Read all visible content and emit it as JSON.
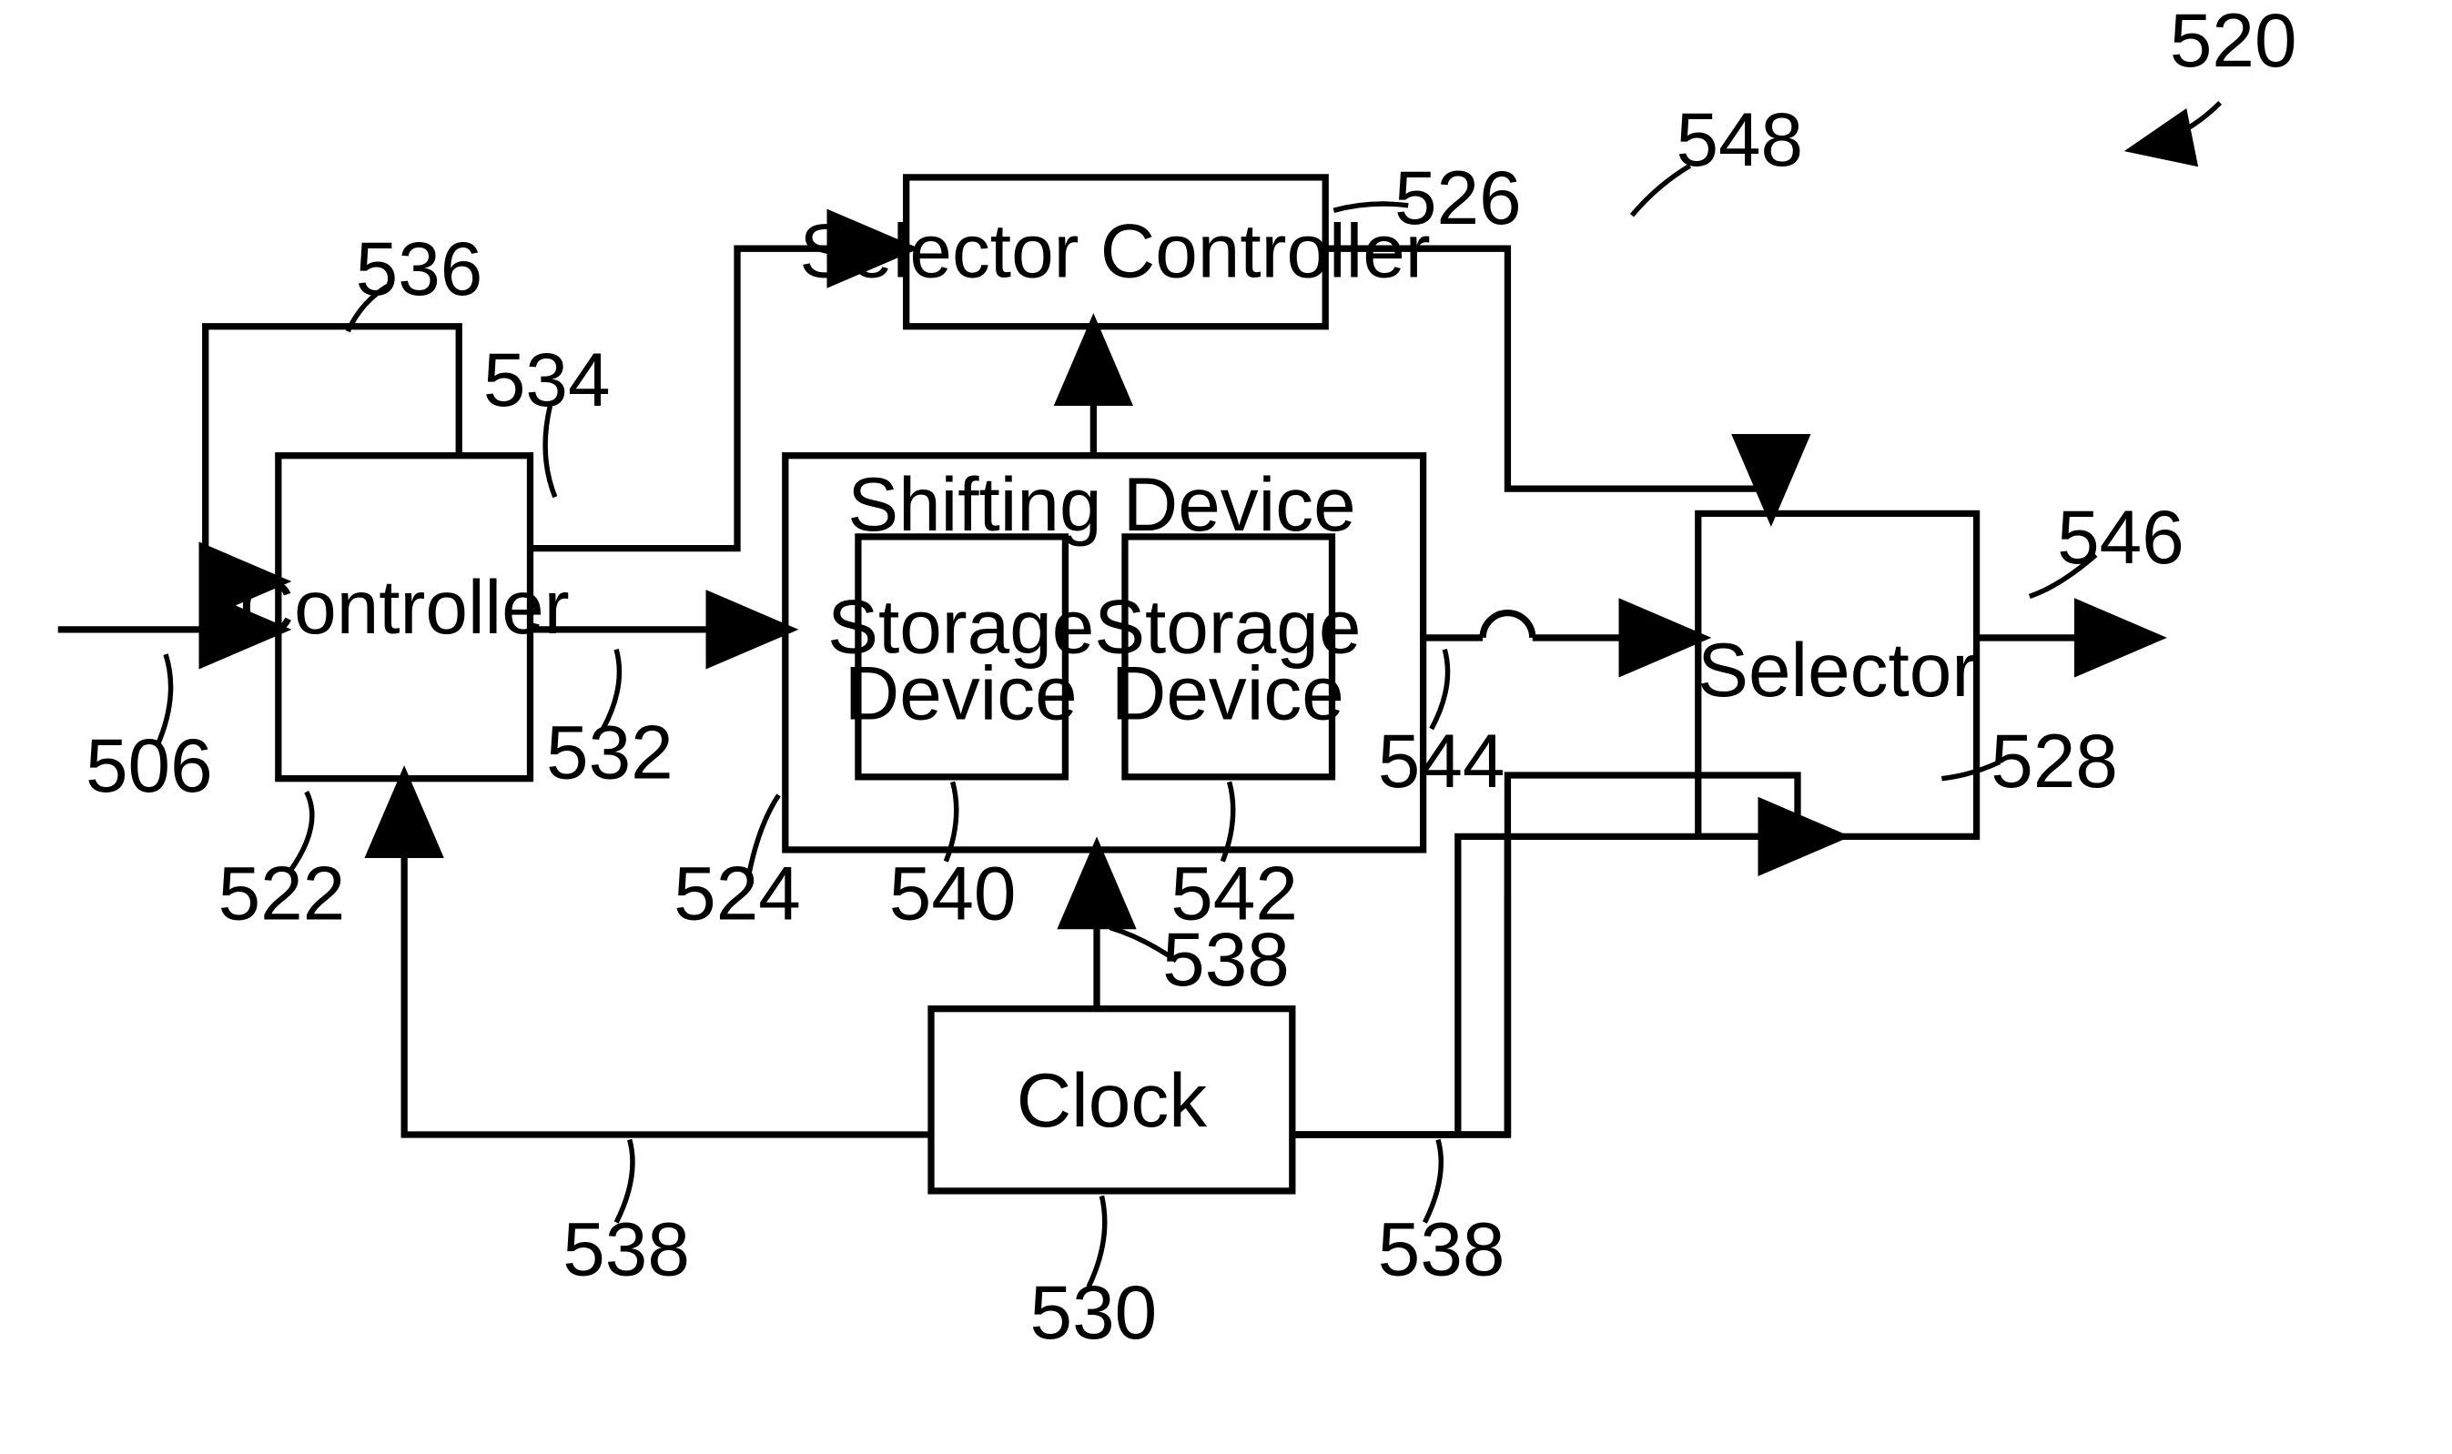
{
  "blocks": {
    "controller": "Controller",
    "selector_controller": "Selector Controller",
    "shifting_device": "Shifting Device",
    "storage_device_a": "Storage\nDevice",
    "storage_device_b": "Storage\nDevice",
    "clock": "Clock",
    "selector": "Selector"
  },
  "refs": {
    "r520": "520",
    "r506": "506",
    "r522": "522",
    "r524": "524",
    "r526": "526",
    "r528": "528",
    "r530": "530",
    "r532": "532",
    "r534": "534",
    "r536": "536",
    "r538_left": "538",
    "r538_mid": "538",
    "r538_right": "538",
    "r540": "540",
    "r542": "542",
    "r544": "544",
    "r546": "546",
    "r548": "548"
  }
}
